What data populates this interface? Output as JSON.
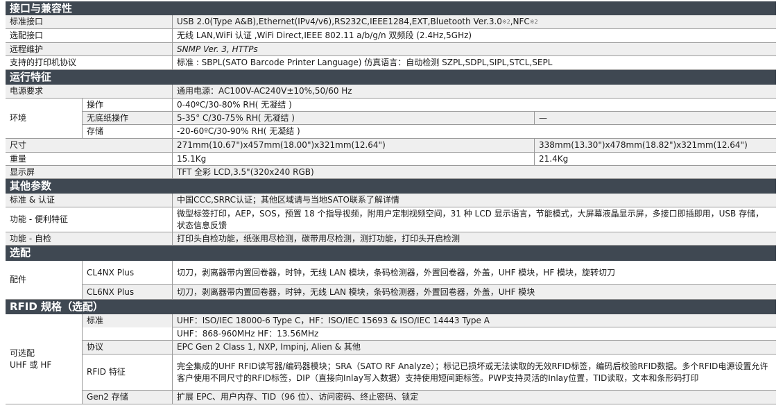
{
  "sections": {
    "interface": "接口与兼容性",
    "operation": "运行特征",
    "other": "其他参数",
    "options": "选配",
    "rfid": "RFID 规格（选配）"
  },
  "interface": {
    "std_label": "标准接口",
    "std_value": "USB 2.0(Type A&B),Ethernet(IPv4/v6),RS232C,IEEE1284,EXT,Bluetooth Ver.3.0",
    "std_sup1": "※2",
    "std_nfc": ",NFC ",
    "std_sup2": "※2",
    "opt_label": "选配接口",
    "opt_value": "无线 LAN,WiFi 认证 ,WiFi Direct,IEEE 802.11 a/b/g/n 双频段 (2.4Hz,5GHz)",
    "remote_label": "远程维护",
    "remote_value": "SNMP Ver. 3, HTTPs",
    "proto_label": "支持的打印机协议",
    "proto_value": "标准 : SBPL(SATO Barcode Printer Language) 仿真语言：自动检测 SZPL,SDPL,SIPL,STCL,SEPL"
  },
  "operation": {
    "power_label": "电源要求",
    "power_value": "通用电源：AC100V-AC240V±10%,50/60 Hz",
    "env_label": "环境",
    "env_op_label": "操作",
    "env_op_value": "0-40ºC/30-80% RH( 无凝结 )",
    "env_nobase_label": "无底纸操作",
    "env_nobase_value": "5-35° C/30-75% RH( 无凝结 )",
    "env_nobase_right": "—",
    "env_store_label": "存储",
    "env_store_value": " -20-60ºC/30-90% RH( 无凝结 )",
    "size_label": "尺寸",
    "size_left": "271mm(10.67\")x457mm(18.00\")x321mm(12.64\")",
    "size_right": "338mm(13.30\")x478mm(18.82\")x321mm(12.64\")",
    "weight_label": "重量",
    "weight_left": "15.1Kg",
    "weight_right": "21.4Kg",
    "display_label": "显示屏",
    "display_value": "TFT 全彩 LCD,3.5\"(320x240 RGB)"
  },
  "other": {
    "cert_label": "标准 & 认证",
    "cert_value": "中国CCC,SRRC认证；其他区域请与当地SATO联系了解详情",
    "conv_label": "功能 - 便利特征",
    "conv_value": "微型标签打印，AEP，SOS，预置 18 个指导视频，附用户定制视频空间，31 种 LCD 显示语言，节能模式，大屏幕液晶显示屏，多接口即插即用，USB 存储，状态信息反馈",
    "selfcheck_label": "功能 - 自检",
    "selfcheck_value": "打印头自检功能，纸张用尽检测，碳带用尽检测，测打功能，打印头开启检测"
  },
  "options": {
    "acc_label": "配件",
    "cl4_label": "CL4NX Plus",
    "cl4_value": "切刀，剥离器带内置回卷器，时钟，无线 LAN 模块，条码检测器，外置回卷器，外盖，UHF 模块，HF 模块，旋转切刀",
    "cl6_label": "CL6NX Plus",
    "cl6_value": "切刀，剥离器带内置回卷器，时钟，无线 LAN 模块，条码检测器，外置回卷器，外盖，UHF 模块"
  },
  "rfid": {
    "group_line1": "可选配",
    "group_line2": "UHF 或 HF",
    "std_label": "标准",
    "std_value": "UHF：ISO/IEC 18000-6 Type C，HF：ISO/IEC 15693 & ISO/IEC 14443 Type A",
    "freq_value": "UHF：868-960MHz    HF：13.56MHz",
    "proto_label": "协议",
    "proto_value": "EPC Gen 2 Class 1, NXP, Impinj, Alien & 其他",
    "feat_label": "RFID 特征",
    "feat_value": "完全集成的UHF RFID读写器/编码器模块；SRA（SATO RF Analyze）；标记已损坏或无法读取的无效RFID标签，编码后校验RFID数据。多个RFID电源设置允许客户使用不同尺寸的RFID标签，DIP（直接向Inlay写入数据）支持使用短间距标签。PWP支持灵活的Inlay位置，TID读取，文本和条形码打印",
    "gen2_label": "Gen2 存储",
    "gen2_value": "扩展 EPC、用户内存、TID（96 位）、访问密码、终止密码、锁定"
  }
}
